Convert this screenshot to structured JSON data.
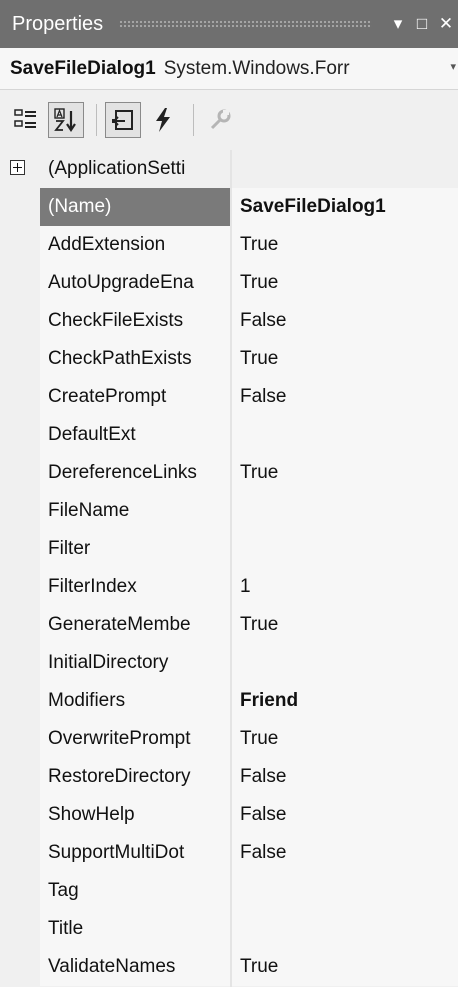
{
  "titlebar": {
    "title": "Properties",
    "dropdown_glyph": "▾",
    "maximize_glyph": "□",
    "close_glyph": "✕"
  },
  "object_selector": {
    "name": "SaveFileDialog1",
    "type": "System.Windows.Forr",
    "dropdown_glyph": "▾"
  },
  "toolbar": {
    "icons": [
      "categorized-icon",
      "alphabetical-icon",
      "properties-icon",
      "events-icon",
      "property-pages-icon"
    ]
  },
  "grid": {
    "category_row": {
      "label": "(ApplicationSetti"
    },
    "rows": [
      {
        "name": "(Name)",
        "value": "SaveFileDialog1",
        "selected": true,
        "bold": true
      },
      {
        "name": "AddExtension",
        "value": "True"
      },
      {
        "name": "AutoUpgradeEna",
        "value": "True"
      },
      {
        "name": "CheckFileExists",
        "value": "False"
      },
      {
        "name": "CheckPathExists",
        "value": "True"
      },
      {
        "name": "CreatePrompt",
        "value": "False"
      },
      {
        "name": "DefaultExt",
        "value": ""
      },
      {
        "name": "DereferenceLinks",
        "value": "True"
      },
      {
        "name": "FileName",
        "value": ""
      },
      {
        "name": "Filter",
        "value": ""
      },
      {
        "name": "FilterIndex",
        "value": "1"
      },
      {
        "name": "GenerateMembe",
        "value": "True"
      },
      {
        "name": "InitialDirectory",
        "value": ""
      },
      {
        "name": "Modifiers",
        "value": "Friend",
        "bold": true
      },
      {
        "name": "OverwritePrompt",
        "value": "True"
      },
      {
        "name": "RestoreDirectory",
        "value": "False"
      },
      {
        "name": "ShowHelp",
        "value": "False"
      },
      {
        "name": "SupportMultiDot",
        "value": "False"
      },
      {
        "name": "Tag",
        "value": ""
      },
      {
        "name": "Title",
        "value": ""
      },
      {
        "name": "ValidateNames",
        "value": "True"
      }
    ]
  }
}
